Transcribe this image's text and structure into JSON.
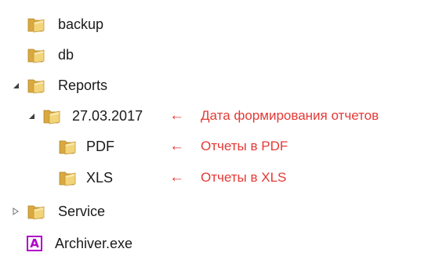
{
  "tree": {
    "items": [
      {
        "label": "backup",
        "icon": "folder-icon",
        "expander": "none"
      },
      {
        "label": "db",
        "icon": "folder-icon",
        "expander": "none"
      },
      {
        "label": "Reports",
        "icon": "folder-icon",
        "expander": "expanded"
      },
      {
        "label": "27.03.2017",
        "icon": "folder-icon",
        "expander": "expanded"
      },
      {
        "label": "PDF",
        "icon": "folder-icon",
        "expander": "none"
      },
      {
        "label": "XLS",
        "icon": "folder-icon",
        "expander": "none"
      },
      {
        "label": "Service",
        "icon": "folder-icon",
        "expander": "collapsed"
      },
      {
        "label": "Archiver.exe",
        "icon": "exe-app-icon",
        "icon_glyph": "A",
        "expander": "none"
      }
    ]
  },
  "annotations": {
    "date_folder": "Дата формирования отчетов",
    "pdf_folder": "Отчеты в PDF",
    "xls_folder": "Отчеты в XLS",
    "arrow_glyph": "←"
  },
  "colors": {
    "annotation": "#e53935",
    "folder_body": "#e8c15a",
    "folder_front": "#f3d77f",
    "exe_icon": "#b000c8"
  }
}
